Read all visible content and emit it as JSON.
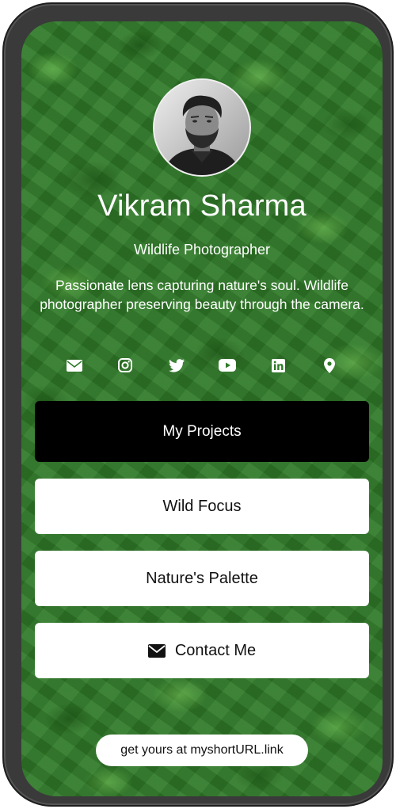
{
  "profile": {
    "name": "Vikram Sharma",
    "role": "Wildlife Photographer",
    "bio": "Passionate lens capturing nature's soul. Wildlife photographer preserving beauty through the camera."
  },
  "socials": [
    {
      "icon": "envelope-icon",
      "label": "Email"
    },
    {
      "icon": "instagram-icon",
      "label": "Instagram"
    },
    {
      "icon": "twitter-icon",
      "label": "Twitter"
    },
    {
      "icon": "youtube-icon",
      "label": "YouTube"
    },
    {
      "icon": "linkedin-icon",
      "label": "LinkedIn"
    },
    {
      "icon": "location-pin-icon",
      "label": "Location"
    }
  ],
  "links": {
    "projects_label": "My Projects",
    "wild_focus_label": "Wild Focus",
    "natures_palette_label": "Nature's Palette",
    "contact_label": "Contact Me"
  },
  "footer": {
    "label": "get yours at myshortURL.link"
  },
  "colors": {
    "background_green": "#2f7a28",
    "primary_button": "#000000",
    "secondary_button": "#ffffff",
    "text_light": "#ffffff",
    "frame": "#3a3a3a"
  }
}
